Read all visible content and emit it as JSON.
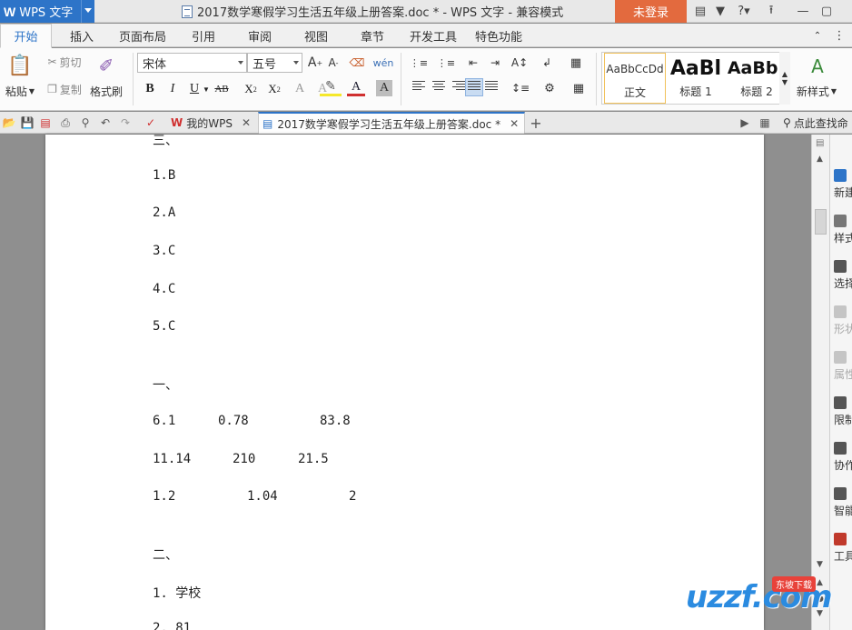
{
  "window": {
    "app_name": "WPS 文字",
    "doc_title": "2017数学寒假学习生活五年级上册答案.doc * - WPS 文字 - 兼容模式",
    "login": "未登录",
    "controls": [
      "minimize-icon",
      "restore-icon",
      "close-icon"
    ]
  },
  "ribbon_tabs": [
    "开始",
    "插入",
    "页面布局",
    "引用",
    "审阅",
    "视图",
    "章节",
    "开发工具",
    "特色功能"
  ],
  "clipboard": {
    "paste": "粘贴",
    "cut": "剪切",
    "copy": "复制",
    "format_painter": "格式刷"
  },
  "font": {
    "family": "宋体",
    "size": "五号"
  },
  "styles": [
    {
      "sample": "AaBbCcDd",
      "name": "正文"
    },
    {
      "sample": "AaBl",
      "name": "标题 1"
    },
    {
      "sample": "AaBb(",
      "name": "标题 2"
    }
  ],
  "new_style": "新样式",
  "doc_tabs": {
    "home": "我的WPS",
    "current": "2017数学寒假学习生活五年级上册答案.doc *",
    "search": "点此查找命"
  },
  "document": {
    "lines": [
      {
        "text": "三、"
      },
      {
        "text": "1.B"
      },
      {
        "text": "2.A"
      },
      {
        "text": "3.C"
      },
      {
        "text": "4.C"
      },
      {
        "text": "5.C"
      },
      {
        "text": "一、"
      },
      {
        "cells": [
          "6.1",
          "0.78",
          "83.8"
        ]
      },
      {
        "cells": [
          "11.14",
          "210",
          "21.5"
        ]
      },
      {
        "cells": [
          "1.2",
          "1.04",
          "2"
        ]
      },
      {
        "text": "二、"
      },
      {
        "text": "1. 学校"
      },
      {
        "text": "2. 81"
      }
    ]
  },
  "right_panel": [
    {
      "label": "新建",
      "enabled": true
    },
    {
      "label": "样式",
      "enabled": true
    },
    {
      "label": "选择",
      "enabled": true
    },
    {
      "label": "形状",
      "enabled": false
    },
    {
      "label": "属性",
      "enabled": false
    },
    {
      "label": "限制",
      "enabled": true
    },
    {
      "label": "协作",
      "enabled": true
    },
    {
      "label": "智能",
      "enabled": true
    },
    {
      "label": "工具",
      "enabled": true
    }
  ],
  "watermark": {
    "text": "uzzf.com",
    "badge": "东坡下载"
  },
  "colors": {
    "accent": "#2d74c8",
    "login": "#e36a3e",
    "workspace": "#8f8f8f"
  }
}
